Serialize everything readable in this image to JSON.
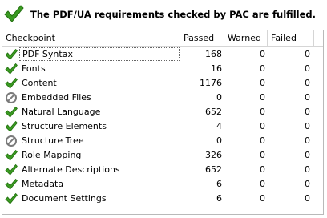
{
  "banner": {
    "message": "The PDF/UA requirements checked by PAC are fulfilled.",
    "icon": "check-icon",
    "color": "#2e8b1f"
  },
  "table": {
    "headers": {
      "checkpoint": "Checkpoint",
      "passed": "Passed",
      "warned": "Warned",
      "failed": "Failed"
    },
    "rows": [
      {
        "name": "PDF Syntax",
        "status": "check",
        "passed": "168",
        "warned": "0",
        "failed": "0"
      },
      {
        "name": "Fonts",
        "status": "check",
        "passed": "16",
        "warned": "0",
        "failed": "0"
      },
      {
        "name": "Content",
        "status": "check",
        "passed": "1176",
        "warned": "0",
        "failed": "0"
      },
      {
        "name": "Embedded Files",
        "status": "na",
        "passed": "0",
        "warned": "0",
        "failed": "0"
      },
      {
        "name": "Natural Language",
        "status": "check",
        "passed": "652",
        "warned": "0",
        "failed": "0"
      },
      {
        "name": "Structure Elements",
        "status": "check",
        "passed": "4",
        "warned": "0",
        "failed": "0"
      },
      {
        "name": "Structure Tree",
        "status": "na",
        "passed": "0",
        "warned": "0",
        "failed": "0"
      },
      {
        "name": "Role Mapping",
        "status": "check",
        "passed": "326",
        "warned": "0",
        "failed": "0"
      },
      {
        "name": "Alternate Descriptions",
        "status": "check",
        "passed": "652",
        "warned": "0",
        "failed": "0"
      },
      {
        "name": "Metadata",
        "status": "check",
        "passed": "6",
        "warned": "0",
        "failed": "0"
      },
      {
        "name": "Document Settings",
        "status": "check",
        "passed": "6",
        "warned": "0",
        "failed": "0"
      }
    ]
  }
}
